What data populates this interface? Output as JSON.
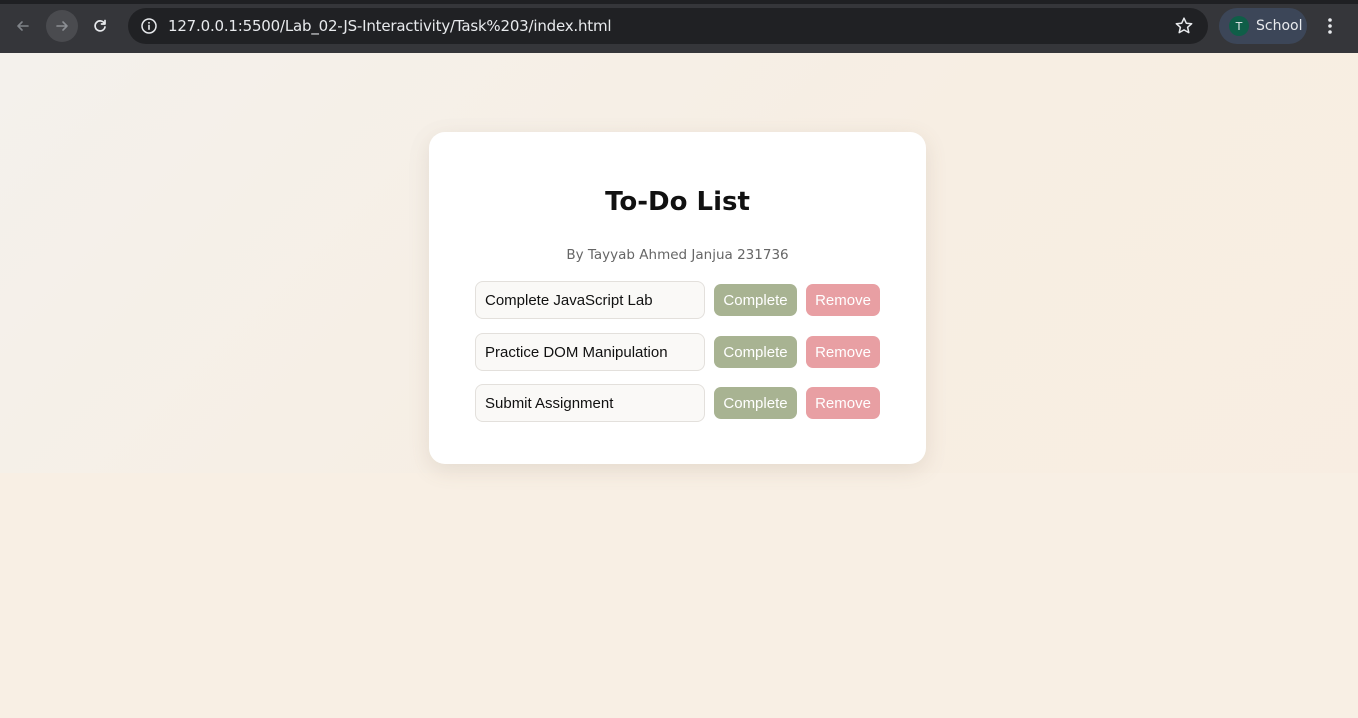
{
  "browser": {
    "url": "127.0.0.1:5500/Lab_02-JS-Interactivity/Task%203/index.html",
    "profile_initial": "T",
    "profile_name": "School",
    "icons": [
      "back-arrow-icon",
      "forward-arrow-icon",
      "reload-icon",
      "info-icon",
      "star-icon",
      "more-vert-icon"
    ]
  },
  "app": {
    "title": "To-Do List",
    "subtitle": "By Tayyab Ahmed Janjua 231736",
    "tasks": [
      {
        "text": "Complete JavaScript Lab",
        "complete_label": "Complete",
        "remove_label": "Remove"
      },
      {
        "text": "Practice DOM Manipulation",
        "complete_label": "Complete",
        "remove_label": "Remove"
      },
      {
        "text": "Submit Assignment",
        "complete_label": "Complete",
        "remove_label": "Remove"
      }
    ]
  },
  "colors": {
    "complete_button": "#a8b392",
    "remove_button": "#e89fa3",
    "page_background": "#f7ede2",
    "card_background": "#ffffff"
  }
}
